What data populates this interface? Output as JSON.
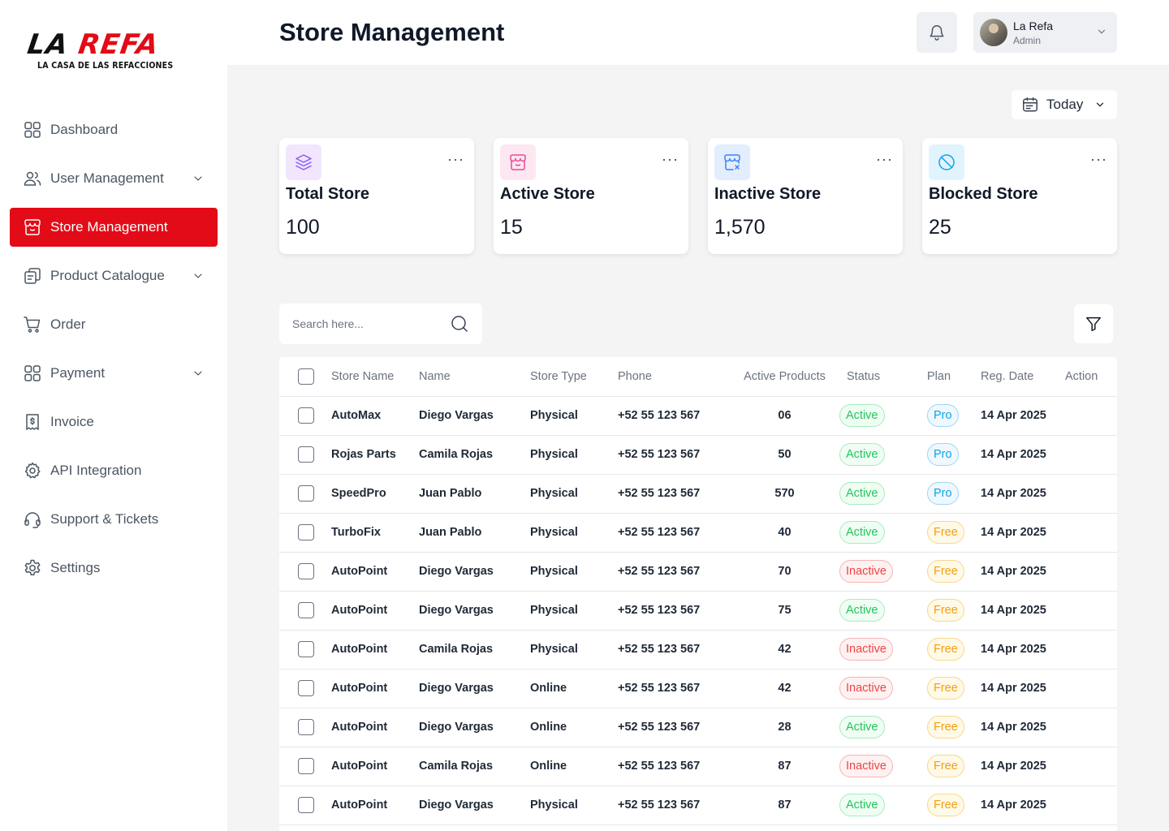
{
  "brand": {
    "logo_main_black": "LA ",
    "logo_main_red": "REFA",
    "logo_sub": "LA CASA DE LAS REFACCIONES",
    "accent": "#e30b17"
  },
  "sidebar": {
    "items": [
      {
        "label": "Dashboard",
        "icon": "grid-icon",
        "expandable": false,
        "active": false
      },
      {
        "label": "User Management",
        "icon": "users-icon",
        "expandable": true,
        "active": false
      },
      {
        "label": "Store Management",
        "icon": "store-icon",
        "expandable": false,
        "active": true
      },
      {
        "label": "Product Catalogue",
        "icon": "catalogue-icon",
        "expandable": true,
        "active": false
      },
      {
        "label": "Order",
        "icon": "cart-icon",
        "expandable": false,
        "active": false
      },
      {
        "label": "Payment",
        "icon": "grid-icon",
        "expandable": true,
        "active": false
      },
      {
        "label": "Invoice",
        "icon": "invoice-icon",
        "expandable": false,
        "active": false
      },
      {
        "label": "API Integration",
        "icon": "gear-cog-icon",
        "expandable": false,
        "active": false
      },
      {
        "label": "Support & Tickets",
        "icon": "headset-icon",
        "expandable": false,
        "active": false
      },
      {
        "label": "Settings",
        "icon": "settings-icon",
        "expandable": false,
        "active": false
      }
    ]
  },
  "header": {
    "title": "Store Management",
    "user": {
      "name": "La Refa",
      "role": "Admin"
    }
  },
  "date_filter": {
    "label": "Today"
  },
  "cards": [
    {
      "title": "Total Store",
      "value": "100",
      "icon": "layers-icon",
      "icon_bg": "#f1e6fe",
      "icon_color": "#8b5cf6"
    },
    {
      "title": "Active Store",
      "value": "15",
      "icon": "store-icon",
      "icon_bg": "#fde7f1",
      "icon_color": "#ec4899"
    },
    {
      "title": "Inactive Store",
      "value": "1,570",
      "icon": "store-x-icon",
      "icon_bg": "#e2edfd",
      "icon_color": "#3b82f6"
    },
    {
      "title": "Blocked Store",
      "value": "25",
      "icon": "blocked-icon",
      "icon_bg": "#e1f3fd",
      "icon_color": "#0ea5e9"
    }
  ],
  "search": {
    "placeholder": "Search here..."
  },
  "table": {
    "columns": [
      "Store Name",
      "Name",
      "Store Type",
      "Phone",
      "Active Products",
      "Status",
      "Plan",
      "Reg. Date",
      "Action"
    ],
    "rows": [
      {
        "store": "AutoMax",
        "name": "Diego Vargas",
        "type": "Physical",
        "phone": "+52 55 123 567",
        "products": "06",
        "status": "Active",
        "plan": "Pro",
        "date": "14 Apr 2025"
      },
      {
        "store": "Rojas Parts",
        "name": "Camila Rojas",
        "type": "Physical",
        "phone": "+52 55 123 567",
        "products": "50",
        "status": "Active",
        "plan": "Pro",
        "date": "14 Apr 2025"
      },
      {
        "store": "SpeedPro",
        "name": "Juan Pablo",
        "type": "Physical",
        "phone": "+52 55 123 567",
        "products": "570",
        "status": "Active",
        "plan": "Pro",
        "date": "14 Apr 2025"
      },
      {
        "store": "TurboFix",
        "name": "Juan Pablo",
        "type": "Physical",
        "phone": "+52 55 123 567",
        "products": "40",
        "status": "Active",
        "plan": "Free",
        "date": "14 Apr 2025"
      },
      {
        "store": "AutoPoint",
        "name": "Diego Vargas",
        "type": "Physical",
        "phone": "+52 55 123 567",
        "products": "70",
        "status": "Inactive",
        "plan": "Free",
        "date": "14 Apr 2025"
      },
      {
        "store": "AutoPoint",
        "name": "Diego Vargas",
        "type": "Physical",
        "phone": "+52 55 123 567",
        "products": "75",
        "status": "Active",
        "plan": "Free",
        "date": "14 Apr 2025"
      },
      {
        "store": "AutoPoint",
        "name": "Camila Rojas",
        "type": "Physical",
        "phone": "+52 55 123 567",
        "products": "42",
        "status": "Inactive",
        "plan": "Free",
        "date": "14 Apr 2025"
      },
      {
        "store": "AutoPoint",
        "name": "Diego Vargas",
        "type": "Online",
        "phone": "+52 55 123 567",
        "products": "42",
        "status": "Inactive",
        "plan": "Free",
        "date": "14 Apr 2025"
      },
      {
        "store": "AutoPoint",
        "name": "Diego Vargas",
        "type": "Online",
        "phone": "+52 55 123 567",
        "products": "28",
        "status": "Active",
        "plan": "Free",
        "date": "14 Apr 2025"
      },
      {
        "store": "AutoPoint",
        "name": "Camila Rojas",
        "type": "Online",
        "phone": "+52 55 123 567",
        "products": "87",
        "status": "Inactive",
        "plan": "Free",
        "date": "14 Apr 2025"
      },
      {
        "store": "AutoPoint",
        "name": "Diego Vargas",
        "type": "Physical",
        "phone": "+52 55 123 567",
        "products": "87",
        "status": "Active",
        "plan": "Free",
        "date": "14 Apr 2025"
      }
    ]
  }
}
